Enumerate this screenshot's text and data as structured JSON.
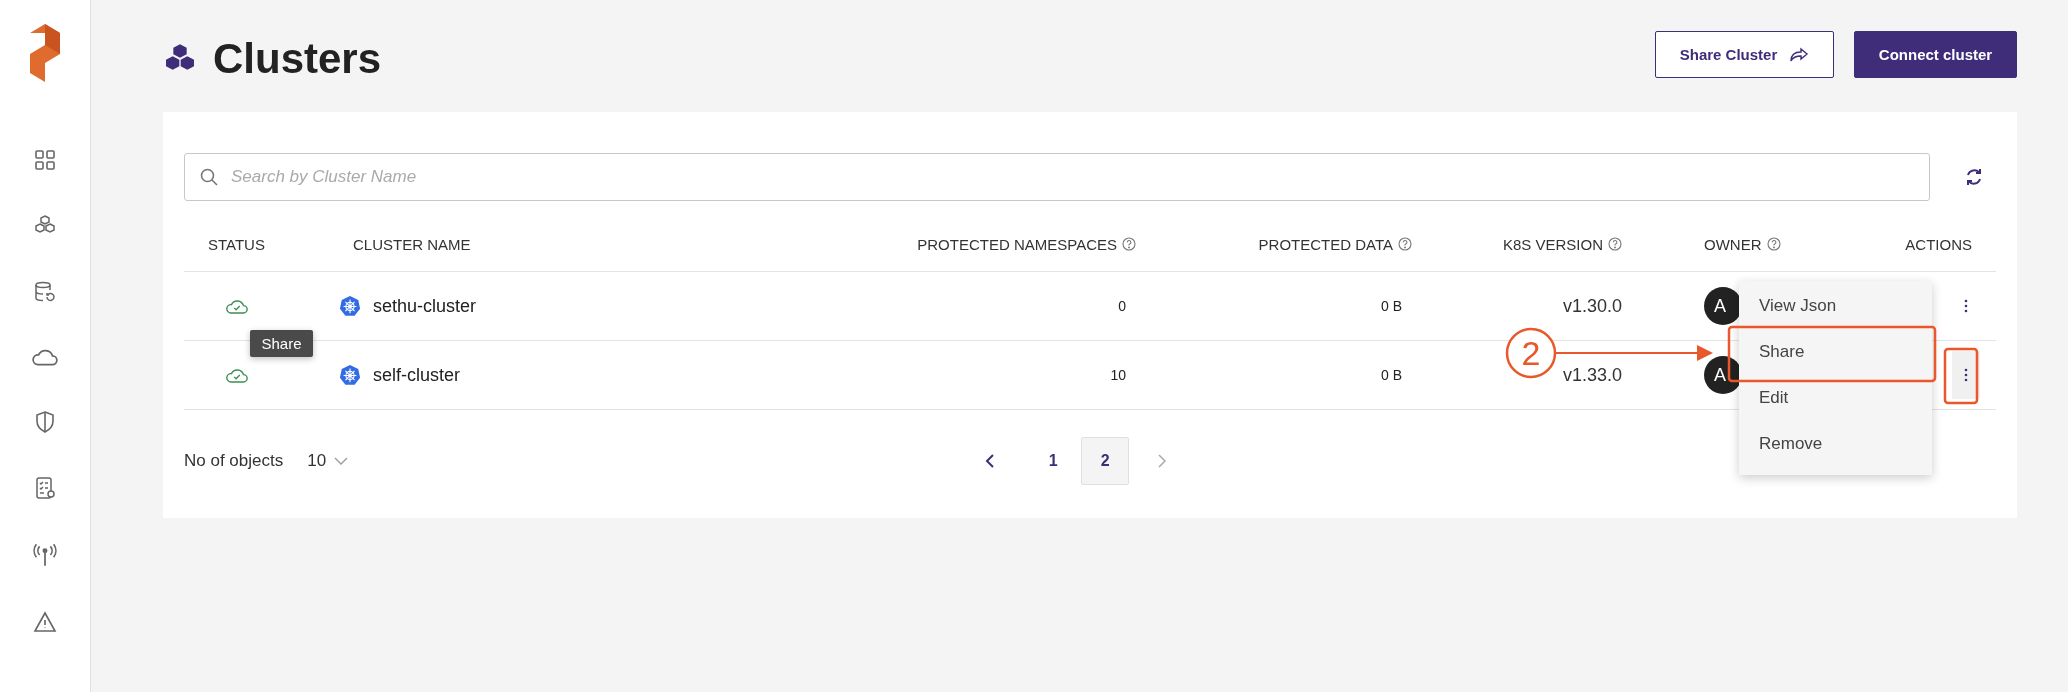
{
  "page": {
    "title": "Clusters"
  },
  "header_buttons": [
    {
      "label": "Share Cluster",
      "kind": "outline"
    },
    {
      "label": "Connect cluster",
      "kind": "primary"
    }
  ],
  "search": {
    "placeholder": "Search by Cluster Name"
  },
  "table": {
    "columns": [
      {
        "label": "STATUS",
        "help": false
      },
      {
        "label": "CLUSTER NAME",
        "help": false
      },
      {
        "label": "PROTECTED NAMESPACES",
        "help": true
      },
      {
        "label": "PROTECTED DATA",
        "help": true
      },
      {
        "label": "K8S VERSION",
        "help": true
      },
      {
        "label": "OWNER",
        "help": true
      },
      {
        "label": "ACTIONS",
        "help": false
      }
    ],
    "rows": [
      {
        "online": true,
        "name": "sethu-cluster",
        "namespaces": "0",
        "data": "0 B",
        "version": "v1.30.0",
        "owner": "A",
        "menu_open": false
      },
      {
        "online": true,
        "name": "self-cluster",
        "namespaces": "10",
        "data": "0 B",
        "version": "v1.33.0",
        "owner": "A",
        "menu_open": true
      }
    ]
  },
  "tooltip": {
    "text": "Share"
  },
  "context_menu": {
    "items": [
      {
        "label": "View Json"
      },
      {
        "label": "Share"
      },
      {
        "label": "Edit"
      },
      {
        "label": "Remove"
      }
    ]
  },
  "pagination": {
    "label": "No of objects",
    "page_size": "10",
    "pages": [
      {
        "label": "1",
        "selected": false
      },
      {
        "label": "2",
        "selected": true
      }
    ]
  },
  "annotation": {
    "step": "2"
  }
}
